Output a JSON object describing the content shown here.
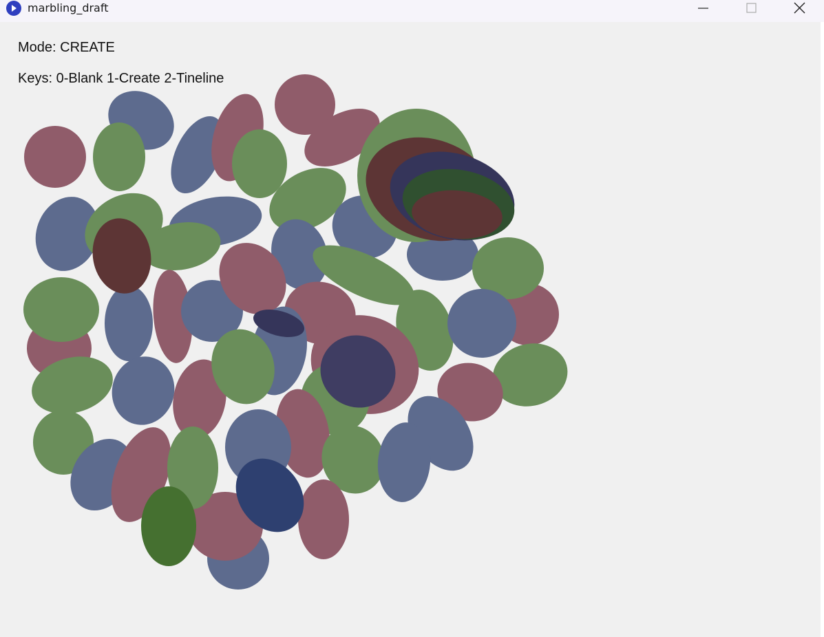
{
  "window": {
    "title": "marbling_draft",
    "controls": {
      "minimize": "minimize",
      "maximize": "maximize",
      "close": "close"
    }
  },
  "hud": {
    "mode_label": "Mode:",
    "mode_value": "CREATE",
    "keys_label": "Keys:",
    "keys": [
      "0-Blank",
      "1-Create",
      "2-Tineline"
    ]
  },
  "colors": {
    "blue": "#5d6b8e",
    "pink": "#905c6a",
    "green": "#6a8e5a",
    "dark_red": "#5d3535",
    "navy": "#35355a",
    "dark_green": "#305030",
    "deep_blue": "#2e4070",
    "forest": "#457030",
    "indigo": "#3f3d62"
  }
}
